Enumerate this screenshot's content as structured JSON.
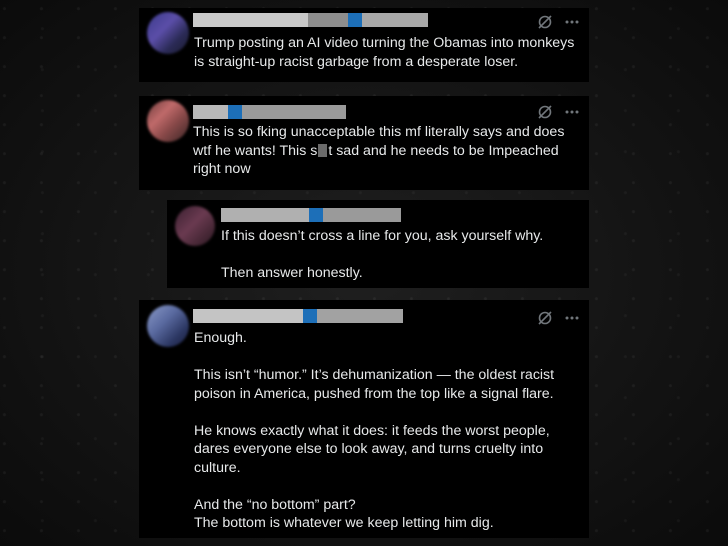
{
  "tweets": [
    {
      "text": "Trump posting an AI video turning the Obamas into monkeys\nis straight-up racist garbage from a desperate loser."
    },
    {
      "text_before": "This is so fking unacceptable this mf literally  says and does\nwtf he wants! This s",
      "text_after": "t sad and he needs to be Impeached\nright now"
    },
    {
      "text": "If this doesn’t cross a line for you, ask yourself why.\n\nThen answer honestly."
    },
    {
      "text": "Enough.\n\nThis isn’t “humor.” It’s dehumanization — the oldest racist\npoison in America, pushed from the top like a signal flare.\n\nHe knows exactly what it does: it feeds the worst people,\ndares everyone else to look away, and turns cruelty into\nculture.\n\nAnd the “no bottom” part?\nThe bottom is whatever we keep letting him dig."
    }
  ],
  "icons": {
    "mute": "grok-slash-icon",
    "more": "more-dots-icon"
  },
  "colors": {
    "card": "#000000",
    "text": "#e7e9ea",
    "muted": "#71767b",
    "pixel_accent": "#1d6fb8"
  }
}
